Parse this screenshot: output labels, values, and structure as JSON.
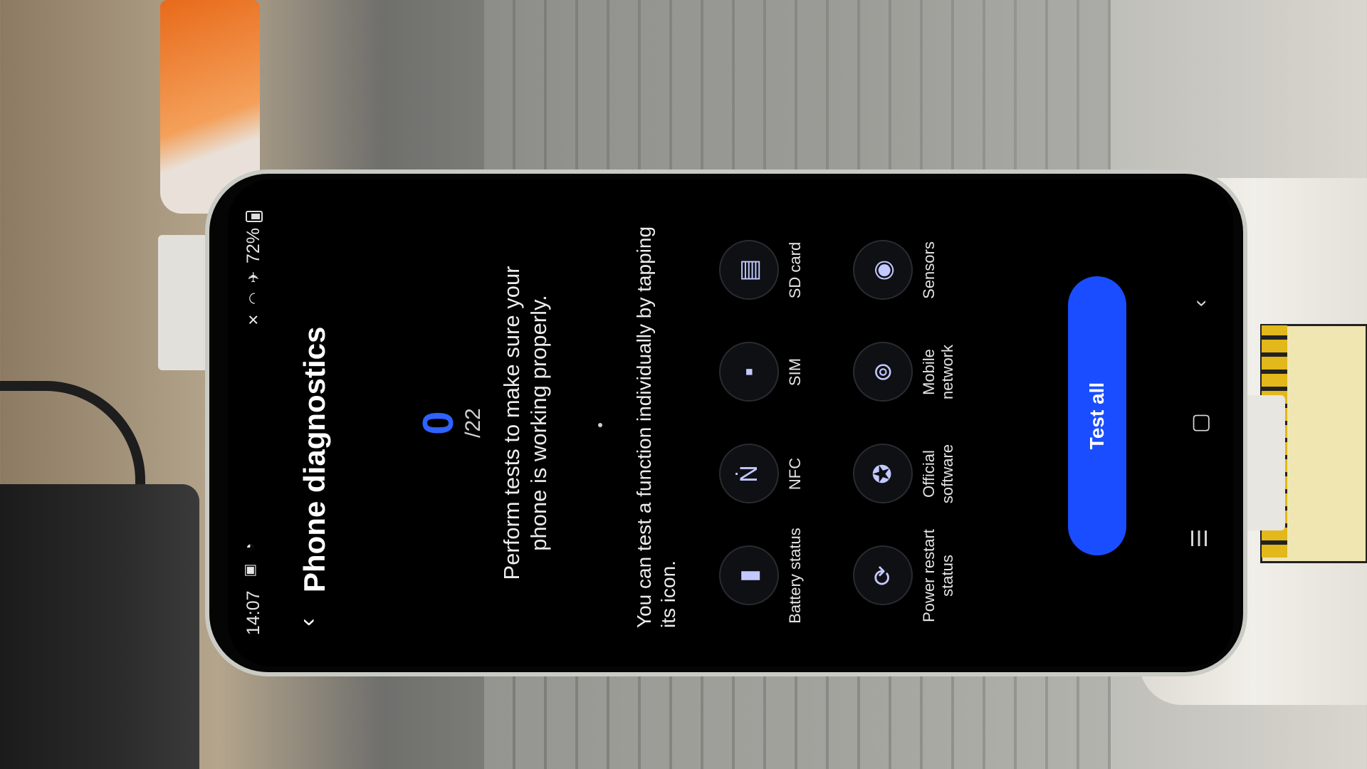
{
  "status_bar": {
    "time": "14:07",
    "battery": "72%"
  },
  "header": {
    "title": "Phone diagnostics"
  },
  "score": {
    "value": "0",
    "total": "/22"
  },
  "intro_text": "Perform tests to make sure your phone is working properly.",
  "hint_text": "You can test a function individually by tapping its icon.",
  "tests": [
    {
      "label": "Battery status",
      "icon": "battery-icon"
    },
    {
      "label": "NFC",
      "icon": "nfc-icon"
    },
    {
      "label": "SIM",
      "icon": "sim-icon"
    },
    {
      "label": "SD card",
      "icon": "sd-card-icon"
    },
    {
      "label": "Power restart status",
      "icon": "power-restart-icon"
    },
    {
      "label": "Official software",
      "icon": "official-software-icon"
    },
    {
      "label": "Mobile network",
      "icon": "mobile-network-icon"
    },
    {
      "label": "Sensors",
      "icon": "sensors-icon"
    }
  ],
  "buttons": {
    "test_all": "Test all"
  },
  "colors": {
    "accent": "#1a4dff",
    "score": "#2f62ff"
  }
}
